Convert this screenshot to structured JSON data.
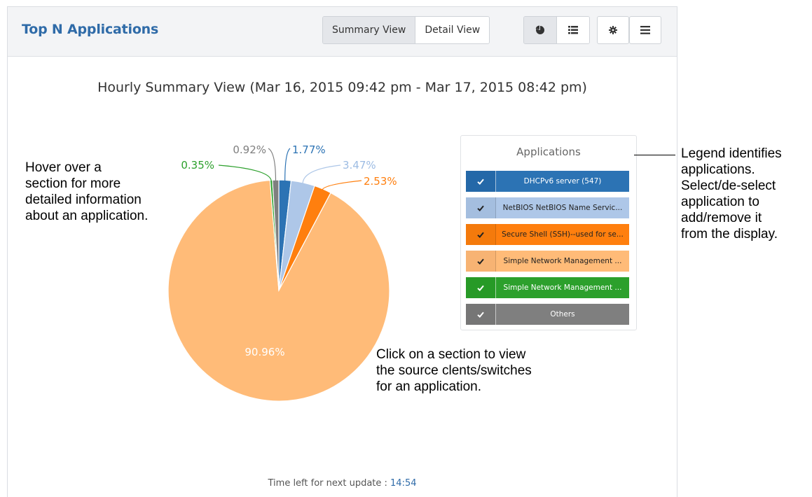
{
  "panel": {
    "title": "Top N Applications",
    "view_toggle": [
      "Summary View",
      "Detail View"
    ],
    "active_view": "Summary View",
    "toolbar_icons": [
      "pie-chart-icon",
      "list-icon",
      "gear-icon",
      "menu-icon"
    ]
  },
  "chart_title": "Hourly Summary View (Mar 16, 2015 09:42 pm - Mar 17, 2015 08:42 pm)",
  "chart_data": {
    "type": "pie",
    "slices": [
      {
        "label": "DHCPv6 server (547)",
        "value": 1.77,
        "display": "1.77%",
        "color": "#2c73b4"
      },
      {
        "label": "NetBIOS NetBIOS Name Servic...",
        "value": 3.47,
        "display": "3.47%",
        "color": "#aec7e8"
      },
      {
        "label": "Secure Shell (SSH)--used for se...",
        "value": 2.53,
        "display": "2.53%",
        "color": "#ff7f0e"
      },
      {
        "label": "Simple Network Management ...",
        "value": 90.96,
        "display": "90.96%",
        "color": "#ffbb78"
      },
      {
        "label": "Simple Network Management ...",
        "value": 0.35,
        "display": "0.35%",
        "color": "#2ca02c"
      },
      {
        "label": "Others",
        "value": 0.92,
        "display": "0.92%",
        "color": "#7f7f7f"
      }
    ]
  },
  "legend": {
    "title": "Applications",
    "items": [
      {
        "label": "DHCPv6 server (547)",
        "color": "#2c73b4",
        "check_color": "#2468a8",
        "text_color": "#ffffff"
      },
      {
        "label": "NetBIOS NetBIOS Name Servic...",
        "color": "#aec7e8",
        "check_color": "#a4bedf",
        "text_color": "#222222"
      },
      {
        "label": "Secure Shell (SSH)--used for se...",
        "color": "#ff7f0e",
        "check_color": "#f47a0c",
        "text_color": "#222222"
      },
      {
        "label": "Simple Network Management ...",
        "color": "#ffbb78",
        "check_color": "#f7b373",
        "text_color": "#222222"
      },
      {
        "label": "Simple Network Management ...",
        "color": "#2ca02c",
        "check_color": "#279a27",
        "text_color": "#ffffff"
      },
      {
        "label": "Others",
        "color": "#7f7f7f",
        "check_color": "#767676",
        "text_color": "#ffffff"
      }
    ]
  },
  "footer": {
    "label": "Time left for next update :",
    "timer": "14:54"
  },
  "annotations": {
    "hover": [
      "Hover over a",
      "section for more",
      "detailed information",
      "about an application."
    ],
    "legend": [
      "Legend identifies",
      "applications.",
      "Select/de-select",
      "application to",
      "add/remove it",
      "from the display."
    ],
    "click": [
      "Click on a section to view",
      "the source clents/switches",
      "for an application."
    ]
  }
}
